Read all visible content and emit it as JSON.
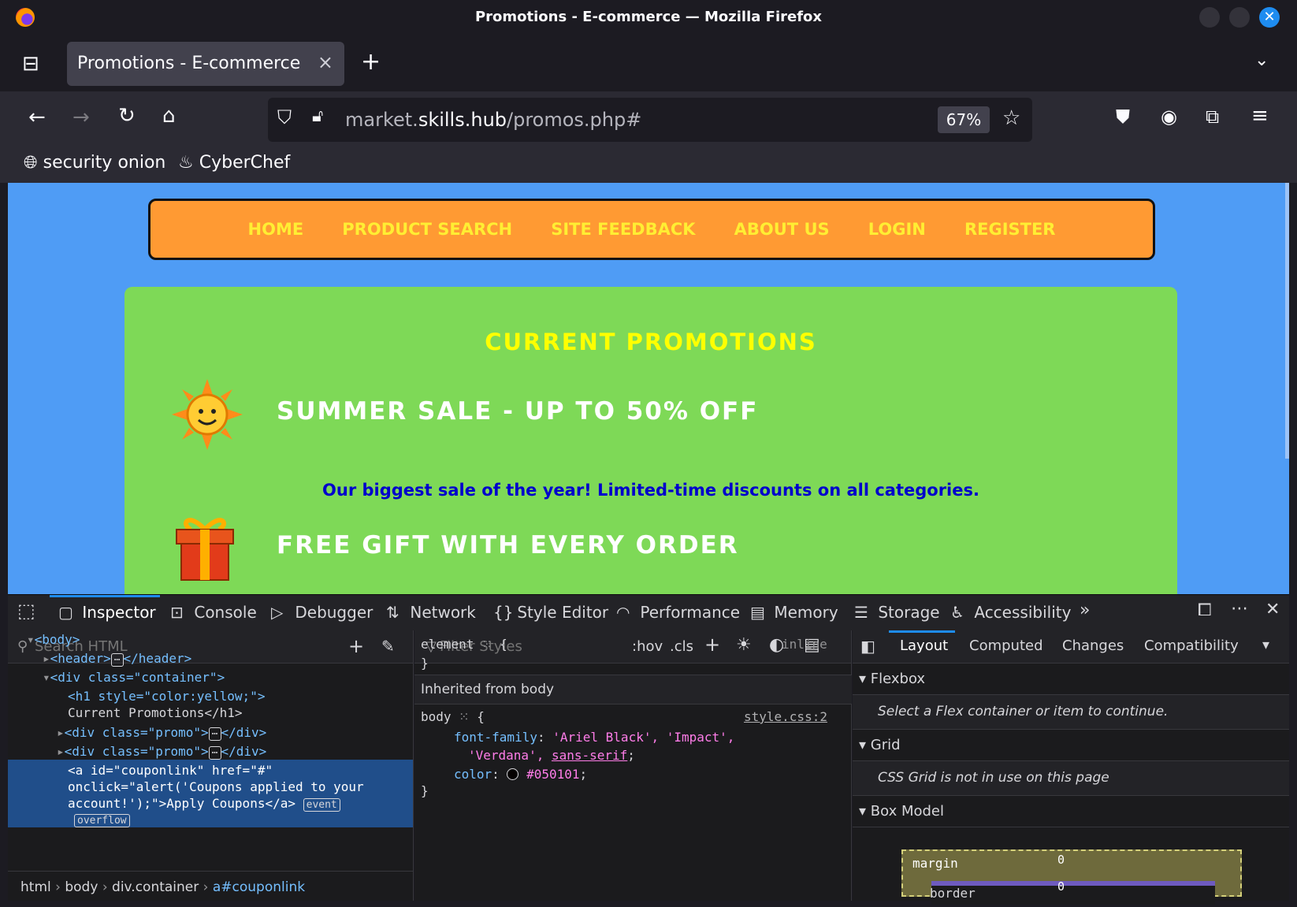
{
  "window": {
    "title": "Promotions - E-commerce — Mozilla Firefox"
  },
  "tab": {
    "label": "Promotions - E-commerce",
    "close": "×",
    "new_tab": "+"
  },
  "nav": {
    "url_host_prefix": "market.",
    "url_host_main": "skills.hub",
    "url_path": "/promos.php#",
    "zoom": "67%"
  },
  "bookmarks": [
    {
      "label": "security onion",
      "icon": "globe-icon"
    },
    {
      "label": "CyberChef",
      "icon": "chef-hat-icon"
    }
  ],
  "site": {
    "menu": [
      "HOME",
      "PRODUCT SEARCH",
      "SITE FEEDBACK",
      "ABOUT US",
      "LOGIN",
      "REGISTER"
    ],
    "heading": "CURRENT PROMOTIONS",
    "promos": [
      {
        "title": "SUMMER SALE - UP TO 50% OFF",
        "icon": "sun-icon",
        "desc": "Our biggest sale of the year! Limited-time discounts on all categories."
      },
      {
        "title": "FREE GIFT WITH EVERY ORDER",
        "icon": "gift-icon"
      }
    ],
    "colors": {
      "background": "#4f9cf5",
      "menu": "#ff9a33",
      "container": "#7ed957",
      "heading": "#ffff00"
    }
  },
  "devtools": {
    "tabs": [
      "Inspector",
      "Console",
      "Debugger",
      "Network",
      "Style Editor",
      "Performance",
      "Memory",
      "Storage",
      "Accessibility"
    ],
    "search_html_placeholder": "Search HTML",
    "filter_styles_placeholder": "Filter Styles",
    "hov": ":hov",
    "cls": ".cls",
    "right_tabs": [
      "Layout",
      "Computed",
      "Changes",
      "Compatibility"
    ],
    "html_tree": {
      "body": "<body>",
      "header_open": "<header>",
      "header_close": "</header>",
      "div_container": "<div class=\"container\">",
      "h1_line1": "<h1 style=\"color:yellow;\">",
      "h1_line2": "Current Promotions</h1>",
      "promo_open": "<div class=\"promo\">",
      "promo_close": "</div>",
      "a_line1": "<a id=\"couponlink\" href=\"#\"",
      "a_line2": "onclick=\"alert('Coupons applied to your",
      "a_line3": "account!');\">Apply Coupons</a>",
      "event_badge": "event",
      "overflow_badge": "overflow"
    },
    "breadcrumbs": [
      "html",
      "body",
      "div.container",
      "a#couponlink"
    ],
    "rules": {
      "element_selector": "element",
      "element_note": "inline",
      "inherited_label": "Inherited from body",
      "body_selector": "body",
      "body_source": "style.css:2",
      "font_family_prop": "font-family",
      "font_family_val": "'Ariel Black', 'Impact',",
      "font_family_val2": "'Verdana',",
      "font_family_val3": "sans-serif",
      "color_prop": "color",
      "color_val": "#050101"
    },
    "layout": {
      "flexbox": "Flexbox",
      "flexbox_note": "Select a Flex container or item to continue.",
      "grid": "Grid",
      "grid_note": "CSS Grid is not in use on this page",
      "box_model": "Box Model",
      "margin_label": "margin",
      "margin_val": "0",
      "border_label": "border",
      "border_val": "0"
    }
  }
}
